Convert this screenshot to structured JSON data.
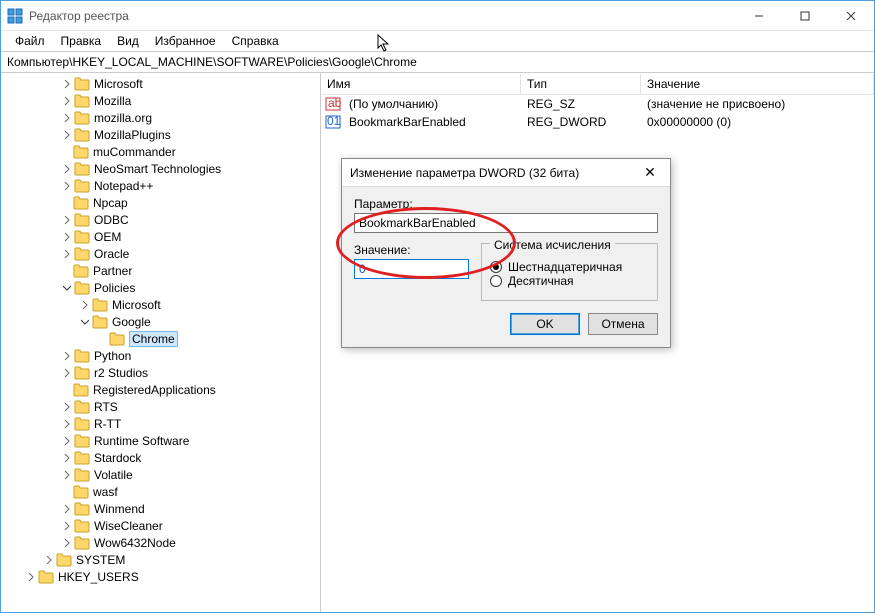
{
  "titlebar": {
    "title": "Редактор реестра"
  },
  "menu": {
    "items": [
      "Файл",
      "Правка",
      "Вид",
      "Избранное",
      "Справка"
    ]
  },
  "address": "Компьютер\\HKEY_LOCAL_MACHINE\\SOFTWARE\\Policies\\Google\\Chrome",
  "tree": {
    "indent_base": 60,
    "items": [
      {
        "label": "Microsoft",
        "depth": 0,
        "twisty": ">"
      },
      {
        "label": "Mozilla",
        "depth": 0,
        "twisty": ">"
      },
      {
        "label": "mozilla.org",
        "depth": 0,
        "twisty": ">"
      },
      {
        "label": "MozillaPlugins",
        "depth": 0,
        "twisty": ">"
      },
      {
        "label": "muCommander",
        "depth": 0,
        "twisty": ""
      },
      {
        "label": "NeoSmart Technologies",
        "depth": 0,
        "twisty": ">"
      },
      {
        "label": "Notepad++",
        "depth": 0,
        "twisty": ">"
      },
      {
        "label": "Npcap",
        "depth": 0,
        "twisty": ""
      },
      {
        "label": "ODBC",
        "depth": 0,
        "twisty": ">"
      },
      {
        "label": "OEM",
        "depth": 0,
        "twisty": ">"
      },
      {
        "label": "Oracle",
        "depth": 0,
        "twisty": ">"
      },
      {
        "label": "Partner",
        "depth": 0,
        "twisty": ""
      },
      {
        "label": "Policies",
        "depth": 0,
        "twisty": "v"
      },
      {
        "label": "Microsoft",
        "depth": 1,
        "twisty": ">"
      },
      {
        "label": "Google",
        "depth": 1,
        "twisty": "v"
      },
      {
        "label": "Chrome",
        "depth": 2,
        "twisty": "",
        "selected": true
      },
      {
        "label": "Python",
        "depth": 0,
        "twisty": ">"
      },
      {
        "label": "r2 Studios",
        "depth": 0,
        "twisty": ">"
      },
      {
        "label": "RegisteredApplications",
        "depth": 0,
        "twisty": ""
      },
      {
        "label": "RTS",
        "depth": 0,
        "twisty": ">"
      },
      {
        "label": "R-TT",
        "depth": 0,
        "twisty": ">"
      },
      {
        "label": "Runtime Software",
        "depth": 0,
        "twisty": ">"
      },
      {
        "label": "Stardock",
        "depth": 0,
        "twisty": ">"
      },
      {
        "label": "Volatile",
        "depth": 0,
        "twisty": ">"
      },
      {
        "label": "wasf",
        "depth": 0,
        "twisty": ""
      },
      {
        "label": "Winmend",
        "depth": 0,
        "twisty": ">"
      },
      {
        "label": "WiseCleaner",
        "depth": 0,
        "twisty": ">"
      },
      {
        "label": "Wow6432Node",
        "depth": 0,
        "twisty": ">"
      },
      {
        "label": "SYSTEM",
        "depth": -1,
        "twisty": ">"
      },
      {
        "label": "HKEY_USERS",
        "depth": -2,
        "twisty": ">"
      }
    ]
  },
  "values": {
    "headers": {
      "name": "Имя",
      "type": "Тип",
      "data": "Значение"
    },
    "rows": [
      {
        "icon": "sz",
        "name": "(По умолчанию)",
        "type": "REG_SZ",
        "data": "(значение не присвоено)"
      },
      {
        "icon": "dw",
        "name": "BookmarkBarEnabled",
        "type": "REG_DWORD",
        "data": "0x00000000 (0)"
      }
    ]
  },
  "dialog": {
    "title": "Изменение параметра DWORD (32 бита)",
    "param_label": "Параметр:",
    "param_value": "BookmarkBarEnabled",
    "value_label": "Значение:",
    "value_value": "0",
    "base_group": "Система исчисления",
    "radio_hex": "Шестнадцатеричная",
    "radio_dec": "Десятичная",
    "ok": "OK",
    "cancel": "Отмена"
  }
}
